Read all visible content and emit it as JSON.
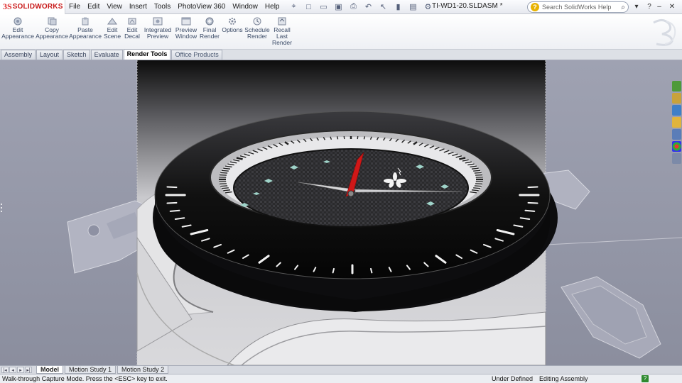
{
  "app": {
    "logo_mark": "3S",
    "logo_text": "SOLIDWORKS",
    "document_title": "TI-WD1-20.SLDASM *"
  },
  "menu": [
    "File",
    "Edit",
    "View",
    "Insert",
    "Tools",
    "PhotoView 360",
    "Window",
    "Help"
  ],
  "search": {
    "placeholder": "Search SolidWorks Help"
  },
  "commands": [
    {
      "l1": "Edit",
      "l2": "Appearance",
      "l3": ""
    },
    {
      "l1": "Copy",
      "l2": "Appearance",
      "l3": ""
    },
    {
      "l1": "Paste",
      "l2": "Appearance",
      "l3": ""
    },
    {
      "l1": "Edit",
      "l2": "Scene",
      "l3": ""
    },
    {
      "l1": "Edit",
      "l2": "Decal",
      "l3": ""
    },
    {
      "l1": "Integrated",
      "l2": "Preview",
      "l3": ""
    },
    {
      "l1": "Preview",
      "l2": "Window",
      "l3": ""
    },
    {
      "l1": "Final",
      "l2": "Render",
      "l3": ""
    },
    {
      "l1": "Options",
      "l2": "",
      "l3": ""
    },
    {
      "l1": "Schedule",
      "l2": "Render",
      "l3": ""
    },
    {
      "l1": "Recall",
      "l2": "Last",
      "l3": "Render"
    }
  ],
  "tabs": [
    "Assembly",
    "Layout",
    "Sketch",
    "Evaluate",
    "Render Tools",
    "Office Products"
  ],
  "active_tab": "Render Tools",
  "bottom_tabs": [
    "Model",
    "Motion Study 1",
    "Motion Study 2"
  ],
  "active_bottom_tab": "Model",
  "status": {
    "message": "Walk-through Capture Mode.  Press the <ESC> key to exit.",
    "state": "Under Defined",
    "mode": "Editing Assembly"
  },
  "colors": {
    "accent_red": "#c81a1a",
    "second_hand": "#d01818",
    "bezel": "#141416",
    "viewport_bg": "#9a9cab"
  },
  "icons": {
    "quick_access": [
      "new-icon",
      "open-icon",
      "save-icon",
      "print-icon",
      "undo-icon",
      "select-icon",
      "rebuild-icon",
      "file-properties-icon",
      "options-icon"
    ],
    "heads_up": [
      "zoom-to-fit-icon",
      "zoom-area-icon",
      "previous-view-icon",
      "section-view-icon",
      "view-orientation-icon",
      "display-style-icon",
      "hide-show-icon",
      "edit-appearance-icon",
      "apply-scene-icon",
      "view-settings-icon"
    ],
    "task_pane": [
      "resources-icon",
      "design-library-icon",
      "file-explorer-icon",
      "search-folder-icon",
      "view-palette-icon",
      "appearances-icon",
      "custom-properties-icon"
    ]
  }
}
